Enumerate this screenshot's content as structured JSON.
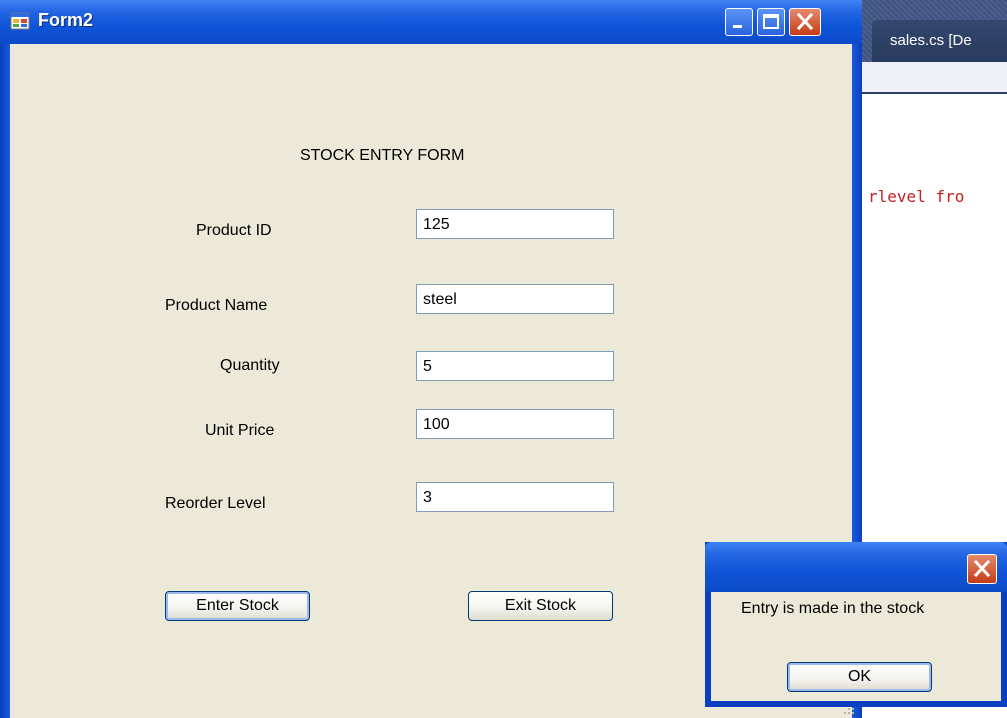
{
  "window": {
    "title": "Form2",
    "app_icon": "form-window-icon",
    "controls": [
      "minimize-icon",
      "maximize-icon",
      "close-icon"
    ]
  },
  "form": {
    "heading": "STOCK ENTRY FORM",
    "fields": [
      {
        "label": "Product ID",
        "value": "125"
      },
      {
        "label": "Product Name",
        "value": "steel"
      },
      {
        "label": "Quantity",
        "value": "5"
      },
      {
        "label": "Unit Price",
        "value": "100"
      },
      {
        "label": "Reorder Level",
        "value": "3"
      }
    ],
    "buttons": {
      "enter_stock": "Enter Stock",
      "exit_stock": "Exit Stock"
    }
  },
  "background_window": {
    "tab_label": "sales.cs [De",
    "code_fragment": "rlevel fro"
  },
  "message_box": {
    "text": "Entry is made in the stock",
    "ok_label": "OK"
  },
  "colors": {
    "titlebar_blue": "#0f54d8",
    "form_background": "#ece9d8",
    "close_red": "#c63c17",
    "code_red": "#c81e1e"
  }
}
